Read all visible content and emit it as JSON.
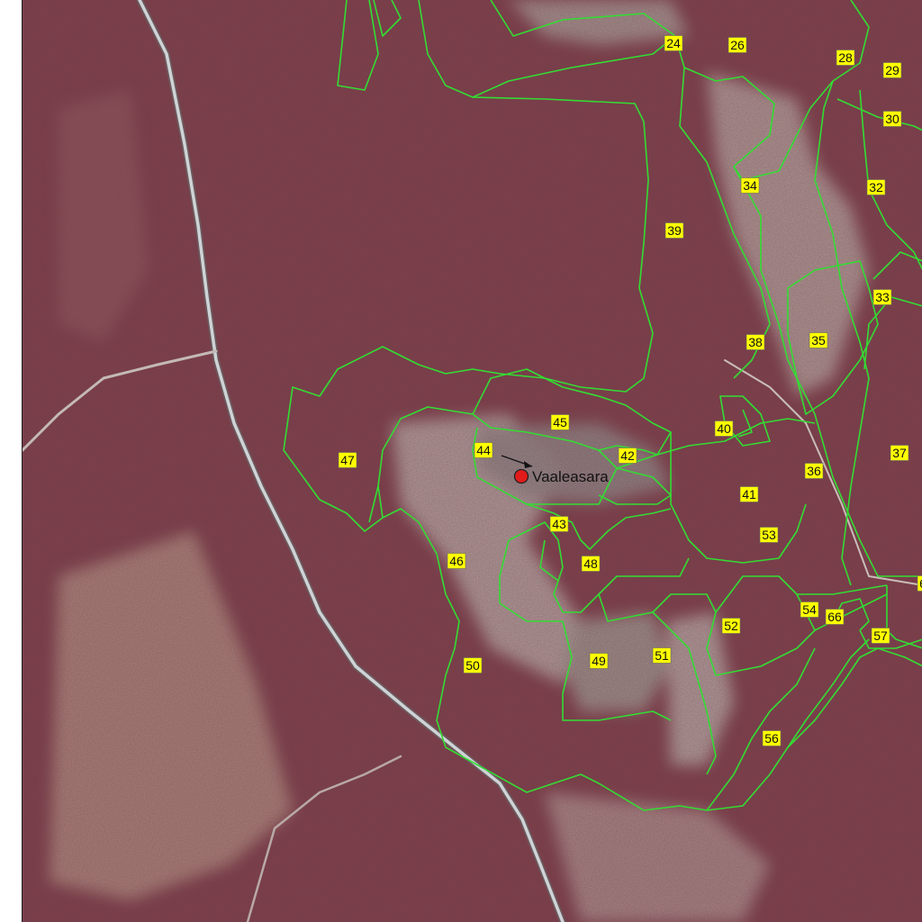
{
  "map": {
    "place_name": "Vaaleasara",
    "colors": {
      "forest": "#7a3f48",
      "forest_dark": "#5e2c36",
      "open_bog": "#b9aea6",
      "bare_ground": "#a98c80",
      "road": "#cfd3d6",
      "boundary": "#33dd33",
      "label_bg": "#ffff00",
      "marker": "#e21b1b"
    },
    "compartment_labels": [
      "24",
      "26",
      "28",
      "29",
      "30",
      "32",
      "34",
      "39",
      "33",
      "35",
      "38",
      "40",
      "45",
      "44",
      "42",
      "47",
      "36",
      "37",
      "41",
      "43",
      "53",
      "46",
      "48",
      "54",
      "66",
      "52",
      "57",
      "50",
      "49",
      "51",
      "56",
      "6"
    ]
  }
}
